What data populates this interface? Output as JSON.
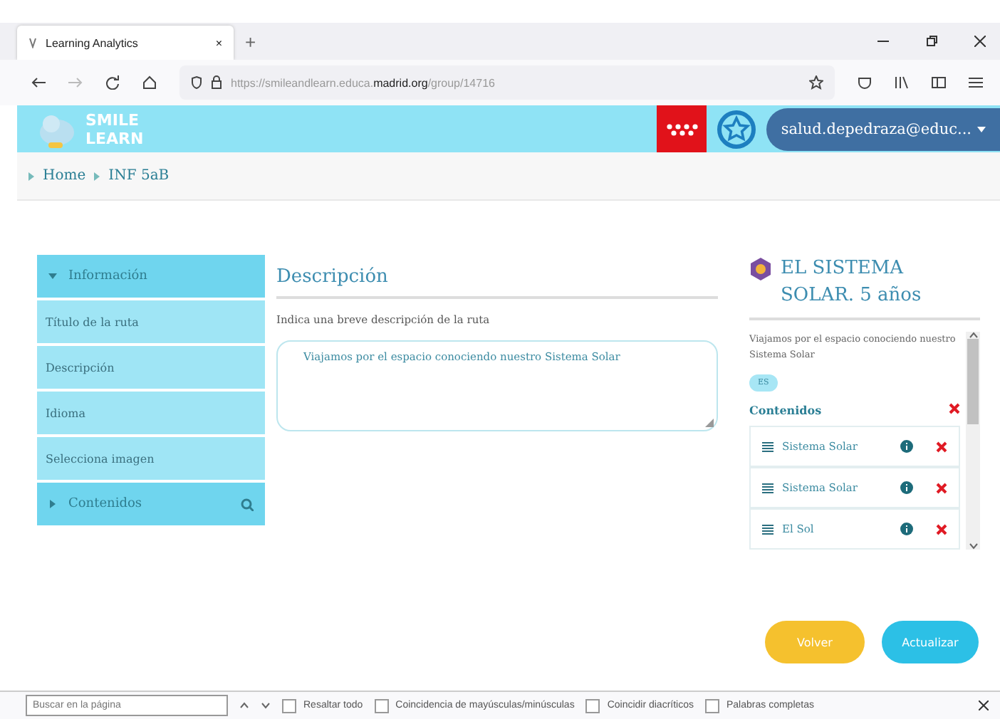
{
  "browser": {
    "tab": {
      "title": "Learning Analytics",
      "close": "×"
    },
    "new_tab": "+",
    "url": {
      "prefix": "https://smileandlearn.educa.",
      "domain": "madrid.org",
      "path": "/group/14716"
    }
  },
  "header": {
    "logo": [
      "SMILE",
      "LEARN"
    ],
    "user": "salud.depedraza@educ..."
  },
  "breadcrumb": [
    "Home",
    "INF 5aB"
  ],
  "sidebar": {
    "items": [
      {
        "label": "Información",
        "kind": "section",
        "expanded": true
      },
      {
        "label": "Título de la ruta",
        "kind": "item"
      },
      {
        "label": "Descripción",
        "kind": "item"
      },
      {
        "label": "Idioma",
        "kind": "item"
      },
      {
        "label": "Selecciona imagen",
        "kind": "item"
      },
      {
        "label": "Contenidos",
        "kind": "section",
        "expanded": false,
        "search": true
      }
    ]
  },
  "main": {
    "title": "Descripción",
    "hint": "Indica una breve descripción de la ruta",
    "value": "Viajamos por el espacio conociendo nuestro Sistema Solar"
  },
  "preview": {
    "title": "EL SISTEMA SOLAR. 5 años",
    "description": "Viajamos por el espacio conociendo nuestro Sistema Solar",
    "language": "ES",
    "contents_heading": "Contenidos",
    "contents": [
      {
        "label": "Sistema Solar"
      },
      {
        "label": "Sistema Solar"
      },
      {
        "label": "El Sol"
      }
    ]
  },
  "buttons": [
    {
      "label": "Volver",
      "kind": "secondary"
    },
    {
      "label": "Actualizar",
      "kind": "primary"
    }
  ],
  "find_bar": {
    "placeholder": "Buscar en la página",
    "options": [
      {
        "label": "Resaltar todo",
        "checked": false
      },
      {
        "label": "Coincidencia de mayúsculas/minúsculas",
        "checked": false
      },
      {
        "label": "Coincidir diacríticos",
        "checked": false
      },
      {
        "label": "Palabras completas",
        "checked": false
      }
    ]
  }
}
